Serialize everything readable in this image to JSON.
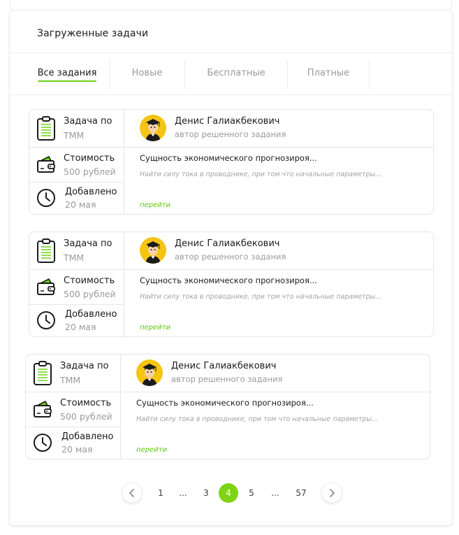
{
  "panel": {
    "title": "Загруженные задачи"
  },
  "tabs": [
    {
      "label": "Все задания",
      "active": true
    },
    {
      "label": "Новые",
      "active": false
    },
    {
      "label": "Бесплатные",
      "active": false
    },
    {
      "label": "Платные",
      "active": false
    }
  ],
  "cards": [
    {
      "task_label": "Задача по",
      "subject": "ТММ",
      "cost_label": "Стоимость",
      "cost_value": "500 рублей",
      "added_label": "Добавлено",
      "added_date": "20 мая",
      "author_name": "Денис Галиакбекович",
      "author_role": "автор решенного задания",
      "task_title": "Сущность экономического прогнозироя...",
      "task_desc": "Найти силу тока в проводнике, при том что начальные параметры...",
      "link_label": "перейти"
    },
    {
      "task_label": "Задача по",
      "subject": "ТММ",
      "cost_label": "Стоимость",
      "cost_value": "500 рублей",
      "added_label": "Добавлено",
      "added_date": "20 мая",
      "author_name": "Денис Галиакбекович",
      "author_role": "автор решенного задания",
      "task_title": "Сущность экономического прогнозироя...",
      "task_desc": "Найти силу тока в проводнике, при том что начальные параметры...",
      "link_label": "перейти"
    },
    {
      "task_label": "Задача по",
      "subject": "ТММ",
      "cost_label": "Стоимость",
      "cost_value": "500 рублей",
      "added_label": "Добавлено",
      "added_date": "20 мая",
      "author_name": "Денис Галиакбекович",
      "author_role": "автор решенного задания",
      "task_title": "Сущность экономического прогнозироя...",
      "task_desc": "Найти силу тока в проводнике, при том что начальные параметры...",
      "link_label": "перейти"
    }
  ],
  "pagination": {
    "prev_icon": "chevron-left-icon",
    "next_icon": "chevron-right-icon",
    "items": [
      "1",
      "...",
      "3",
      "4",
      "5",
      "...",
      "57"
    ],
    "current": "4"
  },
  "colors": {
    "accent": "#7fd316",
    "link": "#5fc70d",
    "avatar_bg": "#f6c413",
    "muted_text": "#9a9a9a",
    "border": "#e6e6e6"
  }
}
